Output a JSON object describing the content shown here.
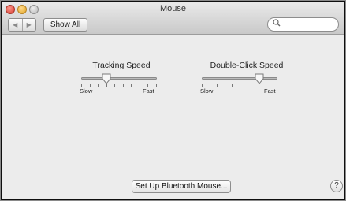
{
  "window": {
    "title": "Mouse"
  },
  "toolbar": {
    "back_icon": "◀",
    "forward_icon": "▶",
    "show_all_label": "Show All",
    "search": {
      "value": "",
      "placeholder": ""
    }
  },
  "tracking_speed": {
    "label": "Tracking Speed",
    "min_label": "Slow",
    "max_label": "Fast",
    "ticks": 10,
    "value_fraction": 0.33
  },
  "double_click_speed": {
    "label": "Double-Click Speed",
    "min_label": "Slow",
    "max_label": "Fast",
    "ticks": 11,
    "value_fraction": 0.76
  },
  "footer": {
    "bluetooth_button_label": "Set Up Bluetooth Mouse...",
    "help_label": "?"
  },
  "colors": {
    "window_bg": "#ececec",
    "frame": "#0e0e0e"
  }
}
